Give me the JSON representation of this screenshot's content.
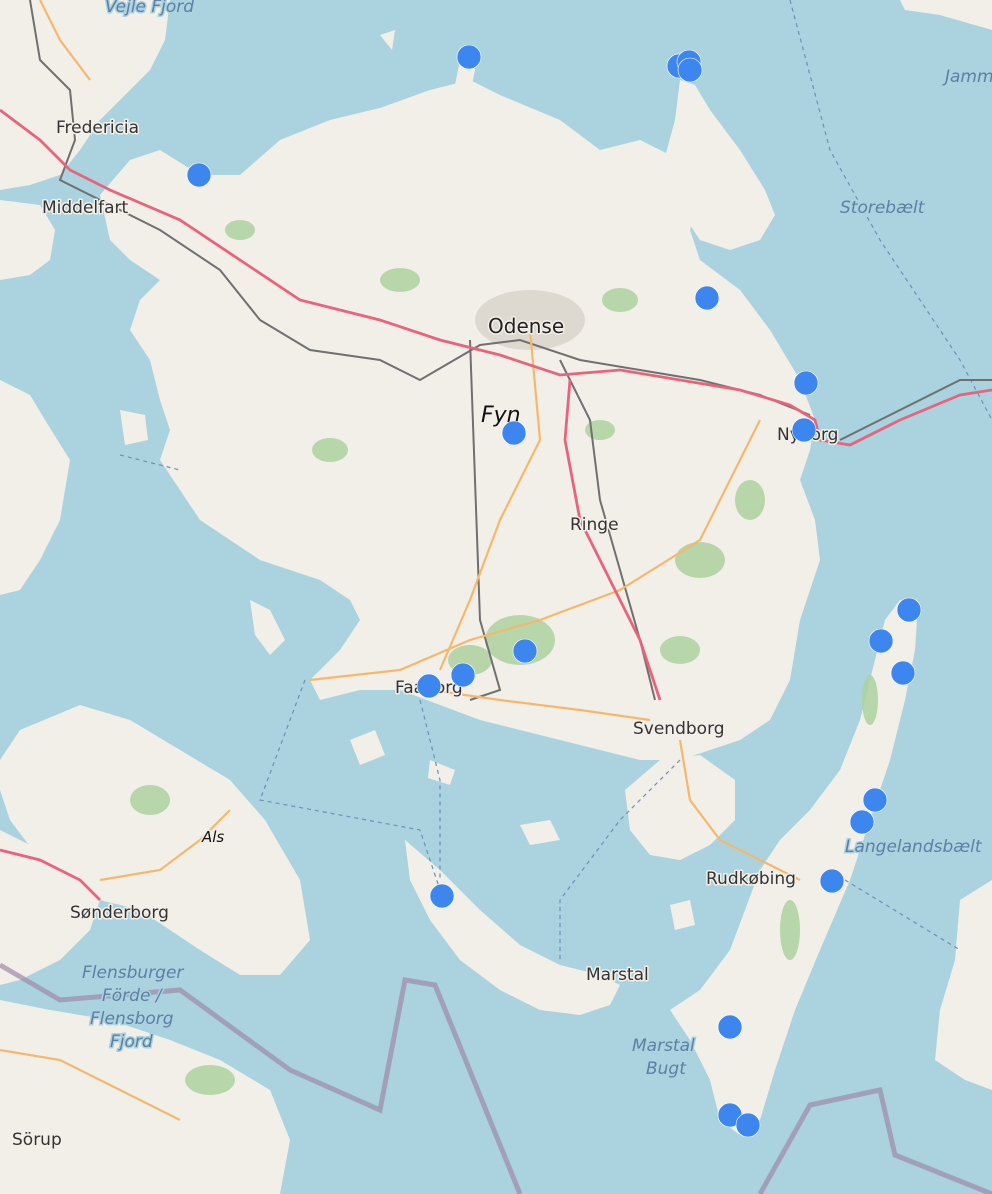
{
  "map": {
    "place_labels": [
      {
        "id": "vejle-fjord",
        "text": "Vejle Fjord",
        "kind": "water"
      },
      {
        "id": "fredericia",
        "text": "Fredericia",
        "kind": "city"
      },
      {
        "id": "middelfart",
        "text": "Middelfart",
        "kind": "city"
      },
      {
        "id": "odense",
        "text": "Odense",
        "kind": "big"
      },
      {
        "id": "fyn",
        "text": "Fyn",
        "kind": "island"
      },
      {
        "id": "ringe",
        "text": "Ringe",
        "kind": "city"
      },
      {
        "id": "nyborg",
        "text": "Nyborg",
        "kind": "city"
      },
      {
        "id": "storebaelt",
        "text": "Storebælt",
        "kind": "water"
      },
      {
        "id": "jammerland",
        "text": "Jammerl",
        "kind": "water"
      },
      {
        "id": "faaborg",
        "text": "Faaborg",
        "kind": "city"
      },
      {
        "id": "svendborg",
        "text": "Svendborg",
        "kind": "city"
      },
      {
        "id": "als",
        "text": "Als",
        "kind": "island"
      },
      {
        "id": "sonderborg",
        "text": "Sønderborg",
        "kind": "city"
      },
      {
        "id": "langelandsbaelt",
        "text": "Langelandsbælt",
        "kind": "water"
      },
      {
        "id": "rudkobing",
        "text": "Rudkøbing",
        "kind": "city"
      },
      {
        "id": "marstal",
        "text": "Marstal",
        "kind": "city"
      },
      {
        "id": "marstal-bugt-1",
        "text": "Marstal",
        "kind": "water"
      },
      {
        "id": "marstal-bugt-2",
        "text": "Bugt",
        "kind": "water"
      },
      {
        "id": "flensburg-1",
        "text": "Flensburger",
        "kind": "water"
      },
      {
        "id": "flensburg-2",
        "text": "Förde /",
        "kind": "water"
      },
      {
        "id": "flensburg-3",
        "text": "Flensborg",
        "kind": "water"
      },
      {
        "id": "flensburg-4",
        "text": "Fjord",
        "kind": "water"
      },
      {
        "id": "sorup",
        "text": "Sörup",
        "kind": "city"
      }
    ],
    "markers": [
      {
        "place": "Bogense coast"
      },
      {
        "place": "Enebærodde"
      },
      {
        "place": "Hindsholm north 1"
      },
      {
        "place": "Hindsholm north 2"
      },
      {
        "place": "Hindsholm north 3"
      },
      {
        "place": "Kerteminde"
      },
      {
        "place": "Nyborg north"
      },
      {
        "place": "Nyborg"
      },
      {
        "place": "Fyn central"
      },
      {
        "place": "Faaborg"
      },
      {
        "place": "Faaborg east"
      },
      {
        "place": "South Fyn hills"
      },
      {
        "place": "Langeland north tip"
      },
      {
        "place": "Langeland north 1"
      },
      {
        "place": "Langeland north 2"
      },
      {
        "place": "Langeland east 1"
      },
      {
        "place": "Langeland east 2"
      },
      {
        "place": "Rudkøbing east"
      },
      {
        "place": "Ærø west"
      },
      {
        "place": "Langeland south 1"
      },
      {
        "place": "Langeland south 2"
      },
      {
        "place": "Langeland south 3"
      }
    ],
    "colors": {
      "water": "#aad3df",
      "land": "#f2efe9",
      "forest": "#add19e",
      "motorway": "#e8647c",
      "trunk": "#f5b86b",
      "railway": "#707070",
      "border": "#9e8aa8",
      "marker": "#3d86f0"
    }
  }
}
